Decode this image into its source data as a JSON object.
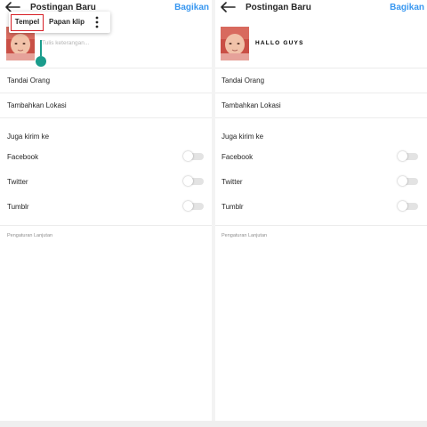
{
  "left": {
    "header": {
      "title": "Postingan Baru",
      "share_label": "Bagikan"
    },
    "caption": {
      "placeholder": "Tulis keterangan..."
    },
    "context_menu": {
      "paste_label": "Tempel",
      "clipboard_label": "Papan klip"
    },
    "rows": {
      "tag_people": "Tandai Orang",
      "add_location": "Tambahkan Lokasi"
    },
    "share_section": {
      "title": "Juga kirim ke",
      "items": [
        {
          "label": "Facebook",
          "enabled": false
        },
        {
          "label": "Twitter",
          "enabled": false
        },
        {
          "label": "Tumblr",
          "enabled": false
        }
      ]
    },
    "advanced_settings": "Pengaturan Lanjutan"
  },
  "right": {
    "header": {
      "title": "Postingan Baru",
      "share_label": "Bagikan"
    },
    "caption": {
      "text": "HALLO GUYS"
    },
    "rows": {
      "tag_people": "Tandai Orang",
      "add_location": "Tambahkan Lokasi"
    },
    "share_section": {
      "title": "Juga kirim ke",
      "items": [
        {
          "label": "Facebook",
          "enabled": false
        },
        {
          "label": "Twitter",
          "enabled": false
        },
        {
          "label": "Tumblr",
          "enabled": false
        }
      ]
    },
    "advanced_settings": "Pengaturan Lanjutan"
  },
  "colors": {
    "accent": "#3897f0",
    "highlight_border": "#d71f26",
    "text_handle": "#1a9c8c",
    "toggle_off": "#e3e3e3"
  }
}
